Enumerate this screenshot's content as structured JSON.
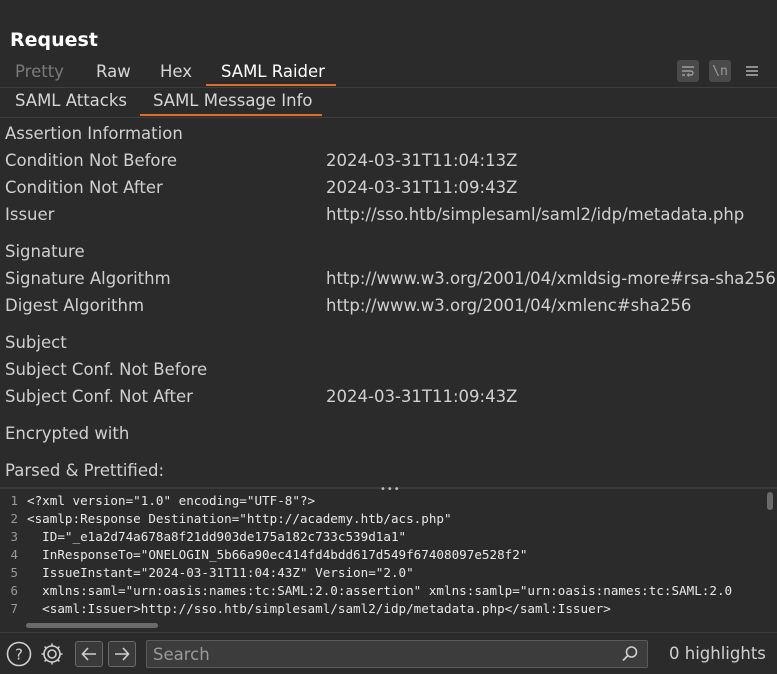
{
  "panel": {
    "title": "Request"
  },
  "view_tabs": [
    {
      "label": "Pretty",
      "state": "disabled"
    },
    {
      "label": "Raw",
      "state": "normal"
    },
    {
      "label": "Hex",
      "state": "normal"
    },
    {
      "label": "SAML Raider",
      "state": "active"
    }
  ],
  "toolbar_icons": [
    "wrap-icon",
    "newline-icon",
    "menu-icon"
  ],
  "toolbar_newline_label": "\\n",
  "sub_tabs": [
    {
      "label": "SAML Attacks",
      "state": "normal"
    },
    {
      "label": "SAML Message Info",
      "state": "active"
    }
  ],
  "info": {
    "assertion_heading": "Assertion Information",
    "condition_not_before_label": "Condition Not Before",
    "condition_not_before_value": "2024-03-31T11:04:13Z",
    "condition_not_after_label": "Condition Not After",
    "condition_not_after_value": "2024-03-31T11:09:43Z",
    "issuer_label": "Issuer",
    "issuer_value": "http://sso.htb/simplesaml/saml2/idp/metadata.php",
    "signature_heading": "Signature",
    "signature_algorithm_label": "Signature Algorithm",
    "signature_algorithm_value": "http://www.w3.org/2001/04/xmldsig-more#rsa-sha256",
    "digest_algorithm_label": "Digest Algorithm",
    "digest_algorithm_value": "http://www.w3.org/2001/04/xmlenc#sha256",
    "subject_heading": "Subject",
    "subject_not_before_label": "Subject Conf. Not Before",
    "subject_not_after_label": "Subject Conf. Not After",
    "subject_not_after_value": "2024-03-31T11:09:43Z",
    "encrypted_with_label": "Encrypted with",
    "parsed_label": "Parsed & Prettified:"
  },
  "code": {
    "line_numbers": [
      "1",
      "2",
      "3",
      "4",
      "5",
      "6",
      "7"
    ],
    "lines": [
      "<?xml version=\"1.0\" encoding=\"UTF-8\"?>",
      "<samlp:Response Destination=\"http://academy.htb/acs.php\"",
      "  ID=\"_e1a2d74a678a8f21dd903de175a182c733c539d1a1\"",
      "  InResponseTo=\"ONELOGIN_5b66a90ec414fd4bdd617d549f67408097e528f2\"",
      "  IssueInstant=\"2024-03-31T11:04:43Z\" Version=\"2.0\"",
      "  xmlns:saml=\"urn:oasis:names:tc:SAML:2.0:assertion\" xmlns:samlp=\"urn:oasis:names:tc:SAML:2.0",
      "  <saml:Issuer>http://sso.htb/simplesaml/saml2/idp/metadata.php</saml:Issuer>"
    ]
  },
  "bottom_bar": {
    "search_placeholder": "Search",
    "highlights": "0 highlights"
  },
  "colors": {
    "accent": "#e06c2c",
    "background": "#2b2b2b"
  }
}
